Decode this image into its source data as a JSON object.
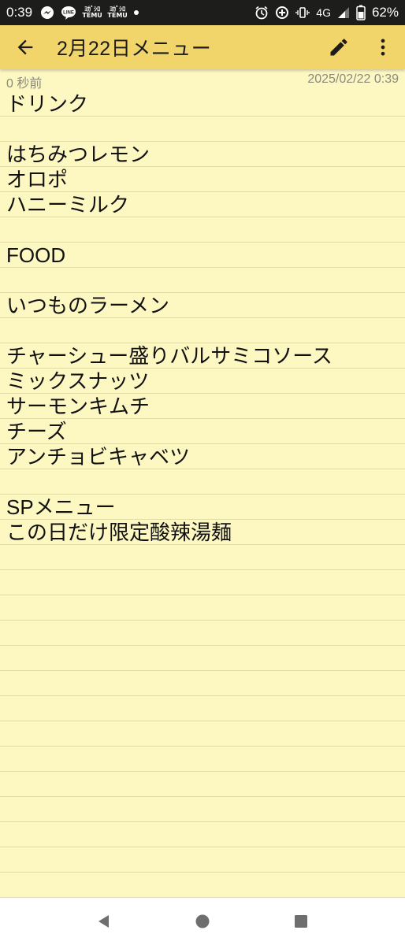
{
  "status_bar": {
    "time": "0:39",
    "app_label_1": "ﾖｶﾞｼﾛ TEMU",
    "app_label_2": "ﾖｶﾞｼﾛ TEMU",
    "network": "4G",
    "battery": "62%"
  },
  "app_bar": {
    "title": "2月22日メニュー",
    "icons": [
      "arrow-back-icon",
      "pencil-icon",
      "more-vert-icon"
    ]
  },
  "meta": {
    "edited_ago": "0 秒前",
    "datetime": "2025/02/22 0:39"
  },
  "note": {
    "lines": [
      "ドリンク",
      "",
      "はちみつレモン",
      "オロポ",
      "ハニーミルク",
      "",
      "FOOD",
      "",
      "いつものラーメン",
      "",
      "チャーシュー盛りバルサミコソース",
      "ミックスナッツ",
      "サーモンキムチ",
      "チーズ",
      "アンチョビキャベツ",
      "",
      "SPメニュー",
      "この日だけ限定酸辣湯麺"
    ]
  },
  "nav_bar": {
    "icons": [
      "back-triangle-icon",
      "home-circle-icon",
      "recents-square-icon"
    ]
  },
  "colors": {
    "status_bg": "#1d1d1b",
    "app_bar_bg": "#f1d56b",
    "note_bg": "#fdf7c2",
    "rule_line": "#e7dc92",
    "meta_text": "#8a8a7a"
  }
}
